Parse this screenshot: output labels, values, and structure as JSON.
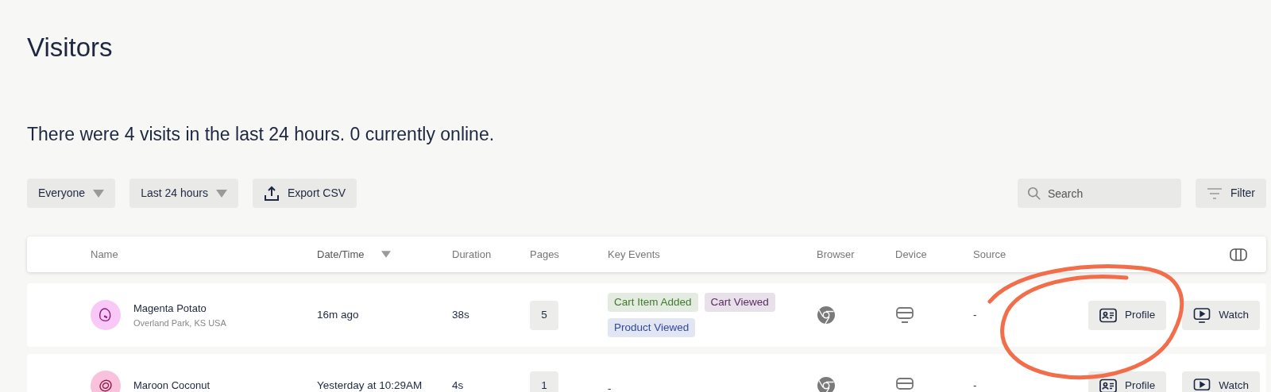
{
  "page_title": "Visitors",
  "summary": "There were 4 visits in the last 24 hours. **0** currently online.",
  "toolbar": {
    "dropdowns": [
      "Everyone",
      "Last 24 hours"
    ],
    "export_button": "Export CSV",
    "search": {
      "placeholder": "Search"
    },
    "filter_button": "Filter"
  },
  "table": {
    "columns": [
      {
        "label": "Name",
        "sorted": false
      },
      {
        "label": "Date/Time",
        "sorted": true
      },
      {
        "label": "Duration",
        "sorted": false
      },
      {
        "label": "Pages",
        "sorted": false
      },
      {
        "label": "Key Events",
        "sorted": false
      },
      {
        "label": "Browser",
        "sorted": false
      },
      {
        "label": "Device",
        "sorted": false
      },
      {
        "label": "Source",
        "sorted": false
      }
    ],
    "rows": [
      {
        "avatar": {
          "kind": "potato",
          "color": "#f8c8f6"
        },
        "name": "Magenta Potato",
        "location": "Overland Park, KS USA",
        "time": "16m ago",
        "duration": "38s",
        "pages": "5",
        "key_events": [
          {
            "label": "Cart Item Added",
            "color": "#3f7a2b"
          },
          {
            "label": "Cart Viewed",
            "color": "#5a2b63"
          },
          {
            "label": "Product Viewed",
            "color": "#2f49a0"
          }
        ],
        "empty_events": "",
        "source": "-",
        "actions": [
          "Profile",
          "Watch"
        ]
      },
      {
        "avatar": {
          "kind": "coconut",
          "color": "#f9c2dc"
        },
        "name": "Maroon Coconut",
        "time": "Yesterday at 10:29AM",
        "duration": "4s",
        "pages": "1",
        "key_events": [],
        "empty_events": "-",
        "source": "-",
        "actions": [
          "Profile",
          "Watch"
        ]
      }
    ]
  }
}
